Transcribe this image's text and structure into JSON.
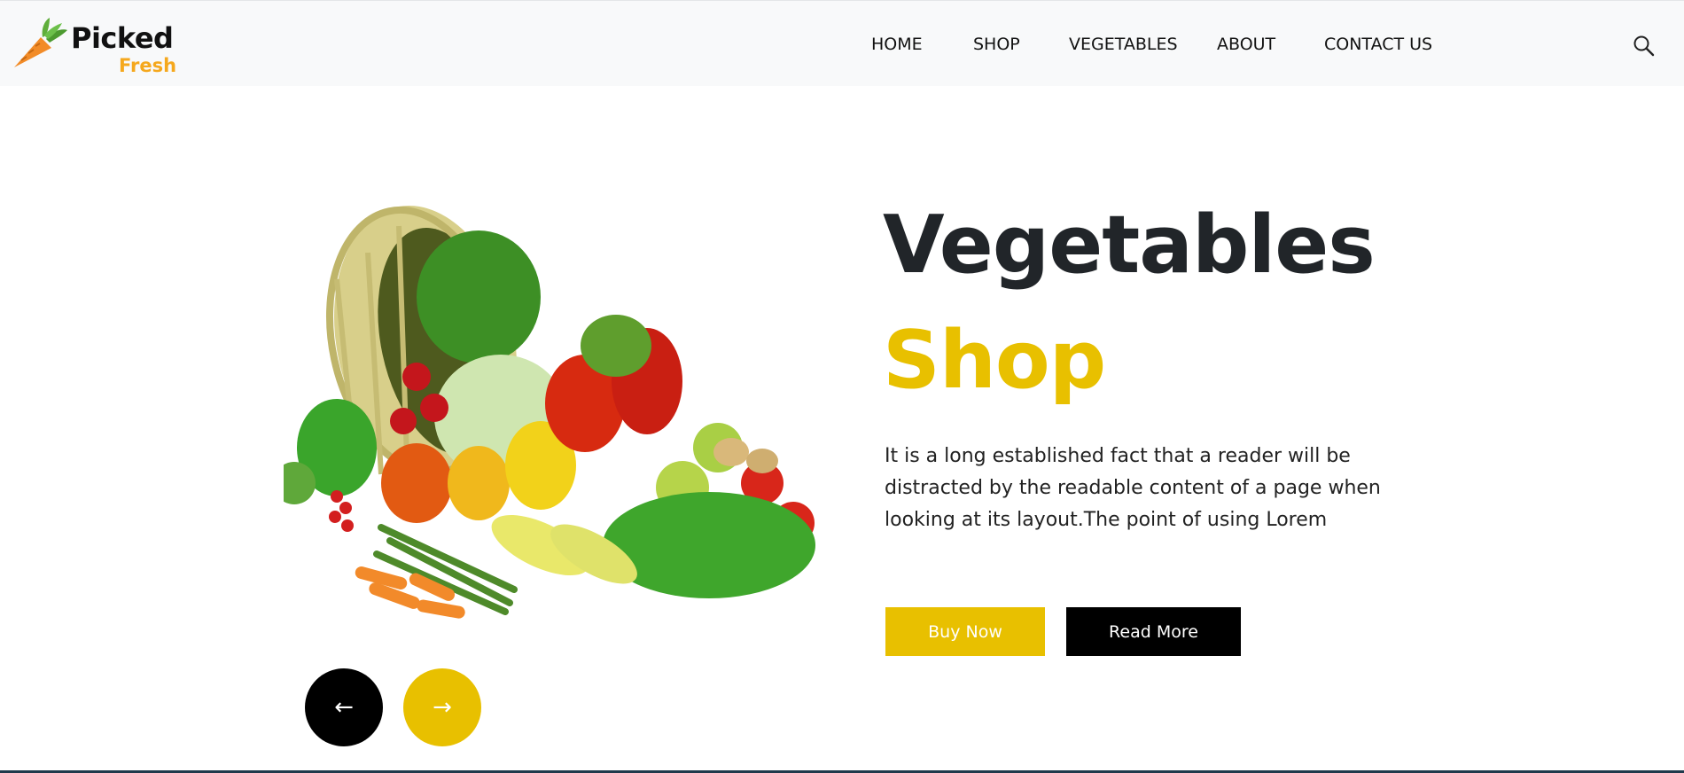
{
  "brand": {
    "name_line1": "Picked",
    "name_line2": "Fresh",
    "icon": "carrot-icon",
    "accent": "#f5a81d"
  },
  "nav": {
    "items": [
      {
        "label": "HOME"
      },
      {
        "label": "SHOP"
      },
      {
        "label": "VEGETABLES"
      },
      {
        "label": "ABOUT"
      },
      {
        "label": "CONTACT US"
      }
    ],
    "search_icon": "search-icon"
  },
  "hero": {
    "title_line1": "Vegetables",
    "title_line2": "Shop",
    "description": "It is a long established fact that a reader will be distracted by the readable content of a page when looking at its layout.The point of using Lorem",
    "buy_label": "Buy Now",
    "read_label": "Read More",
    "prev_arrow": "←",
    "next_arrow": "→",
    "image_icon": "vegetable-basket-illustration"
  },
  "colors": {
    "primary_yellow": "#e8c000",
    "dark": "#212529",
    "header_bg": "#f8f9fa"
  }
}
